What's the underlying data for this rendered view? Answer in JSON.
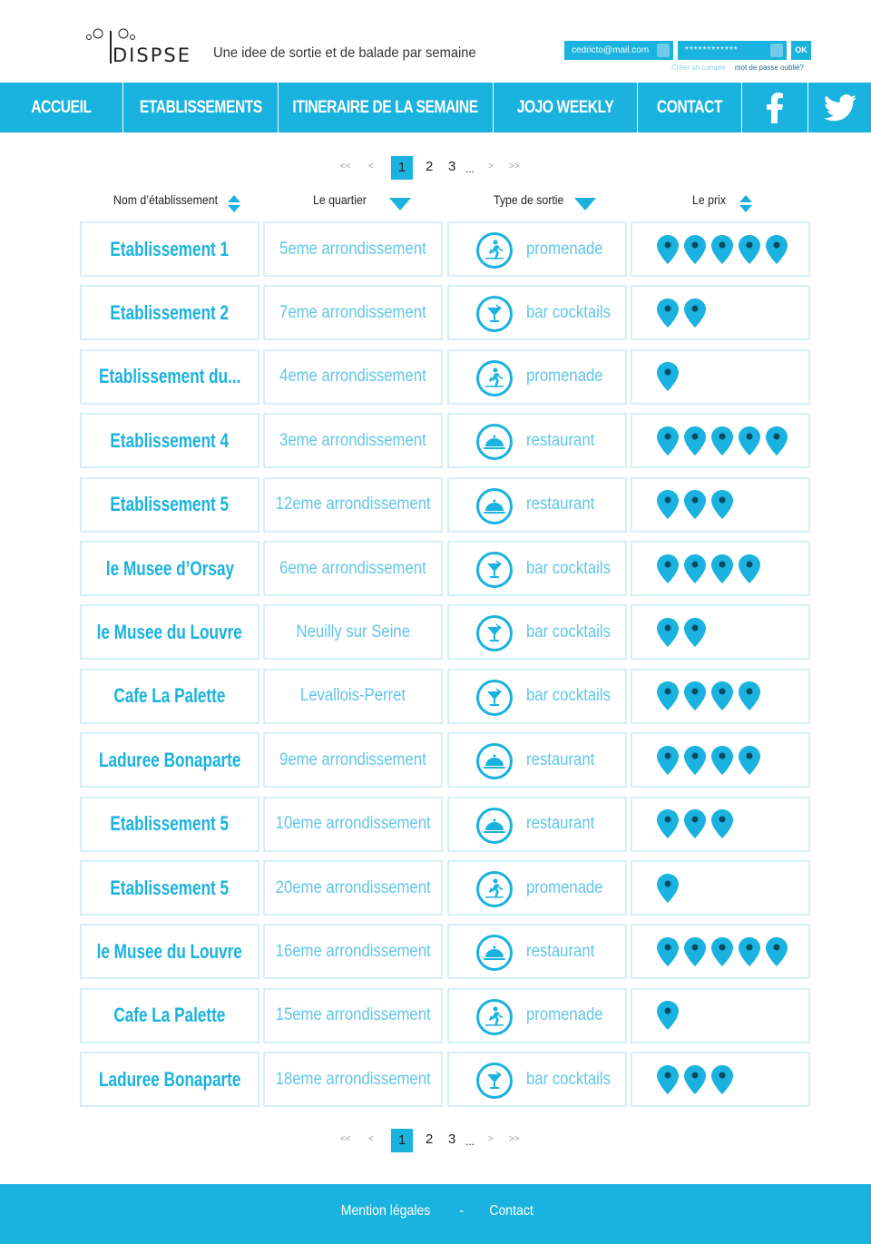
{
  "brand": {
    "logo_text": "DISPSE",
    "tagline": "Une idee de sortie et de balade par semaine"
  },
  "login": {
    "email_value": "cedricto@mail.com",
    "password_value": "************",
    "ok_label": "OK",
    "create_account": "Créer un compte",
    "forgot_password": "mot de passe oublié?"
  },
  "nav": {
    "items": [
      {
        "label": "ACCUEIL"
      },
      {
        "label": "ETABLISSEMENTS"
      },
      {
        "label": "ITINERAIRE DE LA SEMAINE"
      },
      {
        "label": "JOJO WEEKLY"
      },
      {
        "label": "CONTACT"
      }
    ],
    "facebook_icon": "facebook-icon",
    "twitter_icon": "twitter-icon"
  },
  "pagination": {
    "first": "<<",
    "prev": "<",
    "pages": [
      "1",
      "2",
      "3"
    ],
    "current": "1",
    "ellipsis": "...",
    "next": ">",
    "last": ">>"
  },
  "table": {
    "headers": {
      "name": "Nom d’établissement",
      "quartier": "Le  quartier",
      "type": "Type de sortie",
      "price": "Le prix"
    },
    "rows": [
      {
        "name": "Etablissement 1",
        "quartier": "5eme arrondissement",
        "type": "promenade",
        "icon": "walking-icon",
        "price": 5
      },
      {
        "name": "Etablissement 2",
        "quartier": "7eme arrondissement",
        "type": "bar cocktails",
        "icon": "cocktail-icon",
        "price": 2
      },
      {
        "name": "Etablissement du...",
        "quartier": "4eme arrondissement",
        "type": "promenade",
        "icon": "walking-icon",
        "price": 1
      },
      {
        "name": "Etablissement 4",
        "quartier": "3eme arrondissement",
        "type": "restaurant",
        "icon": "cloche-icon",
        "price": 5
      },
      {
        "name": "Etablissement 5",
        "quartier": "12eme arrondissement",
        "type": "restaurant",
        "icon": "cloche-icon",
        "price": 3
      },
      {
        "name": "le Musee d’Orsay",
        "quartier": "6eme arrondissement",
        "type": "bar cocktails",
        "icon": "cocktail-icon",
        "price": 4
      },
      {
        "name": "le Musee du Louvre",
        "quartier": "Neuilly sur Seine",
        "type": "bar cocktails",
        "icon": "cocktail-icon",
        "price": 2
      },
      {
        "name": "Cafe La Palette",
        "quartier": "Levallois-Perret",
        "type": "bar cocktails",
        "icon": "cocktail-icon",
        "price": 4
      },
      {
        "name": "Laduree Bonaparte",
        "quartier": "9eme arrondissement",
        "type": "restaurant",
        "icon": "cloche-icon",
        "price": 4
      },
      {
        "name": "Etablissement 5",
        "quartier": "10eme arrondissement",
        "type": "restaurant",
        "icon": "cloche-icon",
        "price": 3
      },
      {
        "name": "Etablissement 5",
        "quartier": "20eme arrondissement",
        "type": "promenade",
        "icon": "walking-icon",
        "price": 1
      },
      {
        "name": "le Musee du Louvre",
        "quartier": "16eme arrondissement",
        "type": "restaurant",
        "icon": "cloche-icon",
        "price": 5
      },
      {
        "name": "Cafe La Palette",
        "quartier": "15eme arrondissement",
        "type": "promenade",
        "icon": "walking-icon",
        "price": 1
      },
      {
        "name": "Laduree Bonaparte",
        "quartier": "18eme arrondissement",
        "type": "bar cocktails",
        "icon": "cocktail-icon",
        "price": 3
      }
    ]
  },
  "footer": {
    "legal": "Mention légales",
    "separator": "-",
    "contact": "Contact"
  },
  "colors": {
    "accent": "#1ab2de"
  }
}
